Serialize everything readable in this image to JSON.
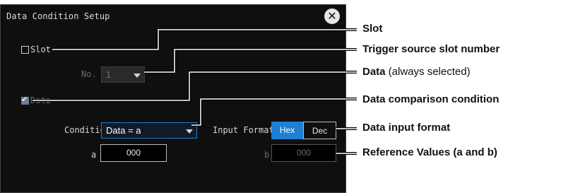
{
  "dialog": {
    "title": "Data Condition Setup",
    "close_glyph": "✕"
  },
  "slot": {
    "label": "Slot",
    "checked": false,
    "number_label": "No.",
    "number_value": "1"
  },
  "data": {
    "label": "Data",
    "checked": true
  },
  "condition": {
    "label": "Condition",
    "value": "Data = a"
  },
  "input_format": {
    "label": "Input Format",
    "options": [
      "Hex",
      "Dec"
    ],
    "selected": "Hex"
  },
  "reference": {
    "a_label": "a",
    "a_value": "000",
    "b_label": "b",
    "b_value": "000"
  },
  "callouts": {
    "slot": "Slot",
    "trigger_slot": "Trigger source slot number",
    "data_bold": "Data",
    "data_note": " (always selected)",
    "comparison": "Data comparison condition",
    "input_format": "Data input format",
    "reference": "Reference Values (a and b)"
  },
  "colors": {
    "accent_blue": "#1e7fd3",
    "dialog_bg": "#0f0f0f"
  }
}
